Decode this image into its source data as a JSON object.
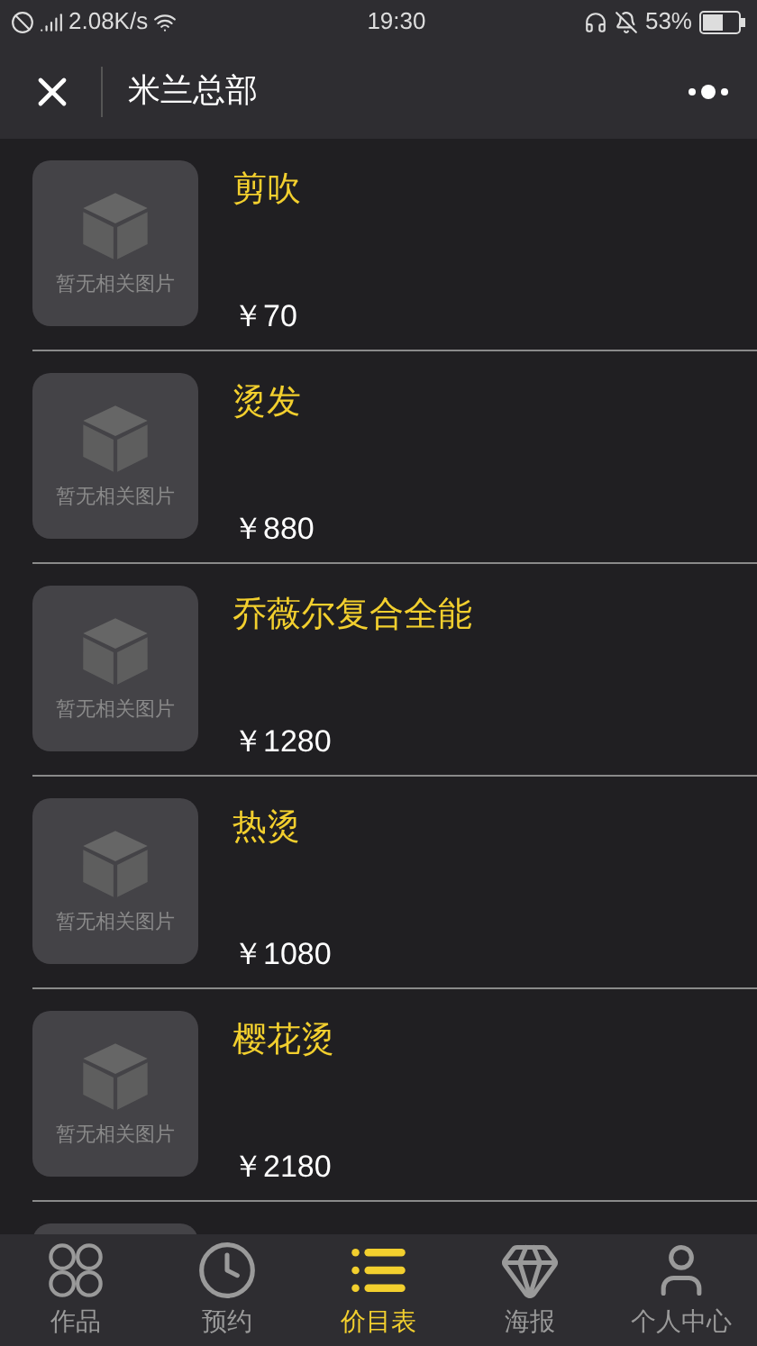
{
  "status_bar": {
    "speed": "2.08K/s",
    "time": "19:30",
    "battery": "53%"
  },
  "nav": {
    "title": "米兰总部"
  },
  "items": [
    {
      "name": "剪吹",
      "price": "￥70",
      "image_placeholder": "暂无相关图片"
    },
    {
      "name": "烫发",
      "price": "￥880",
      "image_placeholder": "暂无相关图片"
    },
    {
      "name": "乔薇尔复合全能",
      "price": "￥1280",
      "image_placeholder": "暂无相关图片"
    },
    {
      "name": "热烫",
      "price": "￥1080",
      "image_placeholder": "暂无相关图片"
    },
    {
      "name": "樱花烫",
      "price": "￥2180",
      "image_placeholder": "暂无相关图片"
    }
  ],
  "tabs": [
    {
      "kind": "grid",
      "label": "作品",
      "selected": false
    },
    {
      "kind": "clock",
      "label": "预约",
      "selected": false
    },
    {
      "kind": "list",
      "label": "价目表",
      "selected": true
    },
    {
      "kind": "gem",
      "label": "海报",
      "selected": false
    },
    {
      "kind": "user",
      "label": "个人中心",
      "selected": false
    }
  ]
}
